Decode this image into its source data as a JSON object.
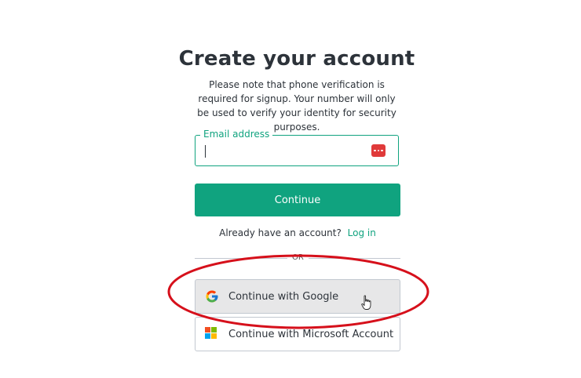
{
  "heading": {
    "title": "Create your account",
    "subtitle": "Please note that phone verification is required for signup. Your number will only be used to verify your identity for security purposes."
  },
  "email": {
    "label": "Email address",
    "value": "",
    "icon": "password-manager-icon"
  },
  "continue_button": {
    "label": "Continue"
  },
  "login": {
    "prompt": "Already have an account?",
    "link": "Log in"
  },
  "divider": {
    "text": "OR"
  },
  "social": [
    {
      "label": "Continue with Google",
      "icon": "google-icon"
    },
    {
      "label": "Continue with Microsoft Account",
      "icon": "microsoft-icon"
    }
  ],
  "colors": {
    "accent": "#10a37f",
    "annotation": "#d6101b",
    "password_icon": "#e03a3a"
  }
}
